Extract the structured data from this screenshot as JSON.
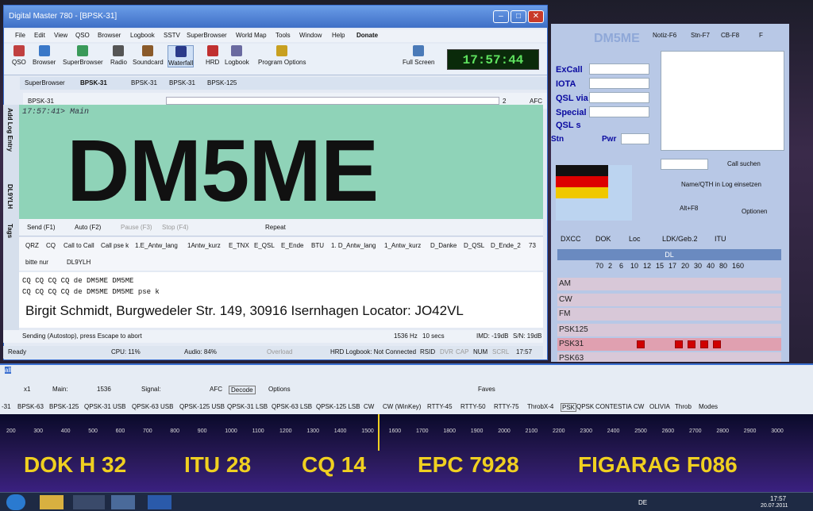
{
  "window": {
    "title": "Digital Master 780 - [BPSK-31]"
  },
  "menu": [
    "File",
    "Edit",
    "View",
    "QSO",
    "Browser",
    "Logbook",
    "SSTV",
    "SuperBrowser",
    "World Map",
    "Tools",
    "Window",
    "Help",
    "Donate"
  ],
  "toolbar": [
    "QSO",
    "Browser",
    "SuperBrowser",
    "Radio",
    "Soundcard",
    "Waterfall",
    "HRD",
    "Logbook",
    "Program Options",
    "Full Screen"
  ],
  "clock": "17:57:44",
  "tabs": [
    "SuperBrowser",
    "BPSK-31",
    "BPSK-31",
    "BPSK-31",
    "BPSK-125"
  ],
  "mode_select": "BPSK-31",
  "afc": "AFC",
  "afc_value": "2",
  "rx": {
    "time": "17:57:41> Main",
    "call": "DM5ME"
  },
  "ctrl": [
    "Send (F1)",
    "Auto (F2)",
    "Pause (F3)",
    "Stop (F4)",
    "Repeat"
  ],
  "macros": [
    "QRZ",
    "CQ",
    "Call to Call",
    "Call pse k",
    "1.E_Antw_lang",
    "1Antw_kurz",
    "E_TNX",
    "E_QSL",
    "E_Ende",
    "BTU",
    "1. D_Antw_lang",
    "1_Antw_kurz",
    "D_Danke",
    "D_QSL",
    "D_Ende_2",
    "73"
  ],
  "macros2": [
    "bitte nur",
    "DL9YLH"
  ],
  "tx": {
    "line1": "CQ CQ CQ CQ  de DM5ME DM5ME",
    "line2": "CQ CQ CQ CQ  de DM5ME DM5ME pse k"
  },
  "address": "Birgit Schmidt, Burgwedeler Str. 149, 30916 Isernhagen Locator: JO42VL",
  "status": {
    "msg": "Sending (Autostop), press Escape to abort",
    "hz": "1536 Hz",
    "secs": "10 secs",
    "imd": "IMD: -19dB",
    "sn": "S/N: 19dB"
  },
  "status2": {
    "ready": "Ready",
    "cpu": "CPU: 11%",
    "audio": "Audio: 84%",
    "overload": "Overload",
    "hrd": "HRD Logbook: Not Connected",
    "rsid": "RSID",
    "dvr": "DVR",
    "cap": "CAP",
    "num": "NUM",
    "scrl": "SCRL",
    "time": "17:57"
  },
  "sidebar": [
    "Add Log Entry",
    "DL9YLH",
    "Tags"
  ],
  "right": {
    "logo": "DM5ME",
    "tabs": [
      "Notiz-F6",
      "Stn-F7",
      "CB-F8",
      "F"
    ],
    "fields": [
      "ExCall",
      "IOTA",
      "QSL via",
      "Special",
      "QSL s",
      "Stn",
      "Pwr"
    ],
    "call_suchen": "Call suchen",
    "name_qth": "Name/QTH in Log einsetzen",
    "alt_f8": "Alt+F8",
    "optionen": "Optionen",
    "dxcc_tabs": [
      "DXCC",
      "DOK",
      "Loc",
      "LDK/Geb.2",
      "ITU"
    ],
    "dl": "DL",
    "bands": [
      "70",
      "2",
      "6",
      "10",
      "12",
      "15",
      "17",
      "20",
      "30",
      "40",
      "80",
      "160"
    ],
    "modes": [
      "AM",
      "CW",
      "FM",
      "PSK125",
      "PSK31",
      "PSK63"
    ]
  },
  "lower": {
    "title": "all",
    "x1": "x1",
    "main": "Main:",
    "freq": "1536",
    "signal": "Signal:",
    "afc": "AFC",
    "decode": "Decode",
    "options": "Options",
    "faves": "Faves",
    "modes": [
      "-31",
      "BPSK-63",
      "BPSK-125",
      "QPSK-31 USB",
      "QPSK-63 USB",
      "QPSK-125 USB",
      "QPSK-31 LSB",
      "QPSK-63 LSB",
      "QPSK-125 LSB",
      "CW",
      "CW (WinKey)",
      "RTTY-45",
      "RTTY-50",
      "RTTY-75",
      "ThrobX-4",
      "PSK",
      "QPSK",
      "CONTESTIA",
      "CW",
      "OLIVIA",
      "Throb",
      "Modes"
    ]
  },
  "scale": [
    "200",
    "300",
    "400",
    "500",
    "600",
    "700",
    "800",
    "900",
    "1000",
    "1100",
    "1200",
    "1300",
    "1400",
    "1500",
    "1600",
    "1700",
    "1800",
    "1900",
    "2000",
    "2100",
    "2200",
    "2300",
    "2400",
    "2500",
    "2600",
    "2700",
    "2800",
    "2900",
    "3000"
  ],
  "info": [
    "DOK H 32",
    "ITU 28",
    "CQ 14",
    "EPC 7928",
    "FIGARAG F086"
  ],
  "taskbar": {
    "lang": "DE",
    "time": "17:57",
    "date": "20.07.2011"
  }
}
